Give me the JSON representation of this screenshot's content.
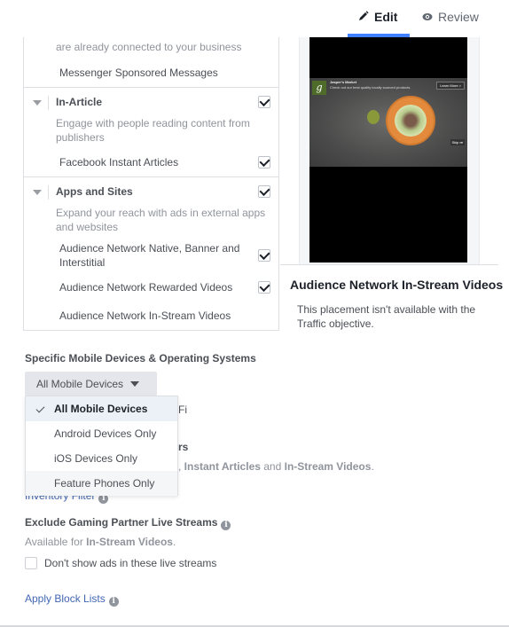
{
  "header": {
    "tabs": [
      {
        "label": "Edit",
        "icon": "pencil-icon",
        "active": true
      },
      {
        "label": "Review",
        "icon": "eye-icon",
        "active": false
      }
    ],
    "accent_color": "#4080ff"
  },
  "placements": {
    "messenger": {
      "desc_tail": "are already connected to your business",
      "items": [
        {
          "label": "Messenger Sponsored Messages",
          "checked": false
        }
      ]
    },
    "in_article": {
      "title": "In-Article",
      "checked": true,
      "description": "Engage with people reading content from publishers",
      "items": [
        {
          "label": "Facebook Instant Articles",
          "checked": true
        }
      ]
    },
    "apps_sites": {
      "title": "Apps and Sites",
      "checked": true,
      "description": "Expand your reach with ads in external apps and websites",
      "items": [
        {
          "label": "Audience Network Native, Banner and Interstitial",
          "checked": true
        },
        {
          "label": "Audience Network Rewarded Videos",
          "checked": true
        },
        {
          "label": "Audience Network In-Stream Videos",
          "checked": false
        }
      ]
    }
  },
  "preview": {
    "ad": {
      "brand": "Jasper's Market",
      "text": "Check out our best quality locally sourced products.",
      "cta": "Learn More >",
      "skip": "Skip ⏭",
      "logo_letter": "g"
    },
    "title": "Audience Network In-Stream Videos",
    "note": "This placement isn't available with the Traffic objective."
  },
  "devices": {
    "label": "Specific Mobile Devices & Operating Systems",
    "selected": "All Mobile Devices",
    "options": [
      {
        "label": "All Mobile Devices",
        "selected": true
      },
      {
        "label": "Android Devices Only",
        "selected": false
      },
      {
        "label": "iOS Devices Only",
        "selected": false
      },
      {
        "label": "Feature Phones Only",
        "selected": false
      }
    ]
  },
  "obscured": {
    "wifi_tail": "Fi",
    "publishers_tail": "rs",
    "available_tail_prefix": ", ",
    "available_bold_1": "Instant Articles",
    "available_mid": " and ",
    "available_bold_2": "In-Stream Videos",
    "available_end": ".",
    "inventory_filter": "Inventory Filter"
  },
  "gaming": {
    "title": "Exclude Gaming Partner Live Streams",
    "available_prefix": "Available for ",
    "available_bold": "In-Stream Videos",
    "available_end": ".",
    "checkbox_label": "Don't show ads in these live streams",
    "checked": false
  },
  "block_lists": {
    "label": "Apply Block Lists"
  }
}
